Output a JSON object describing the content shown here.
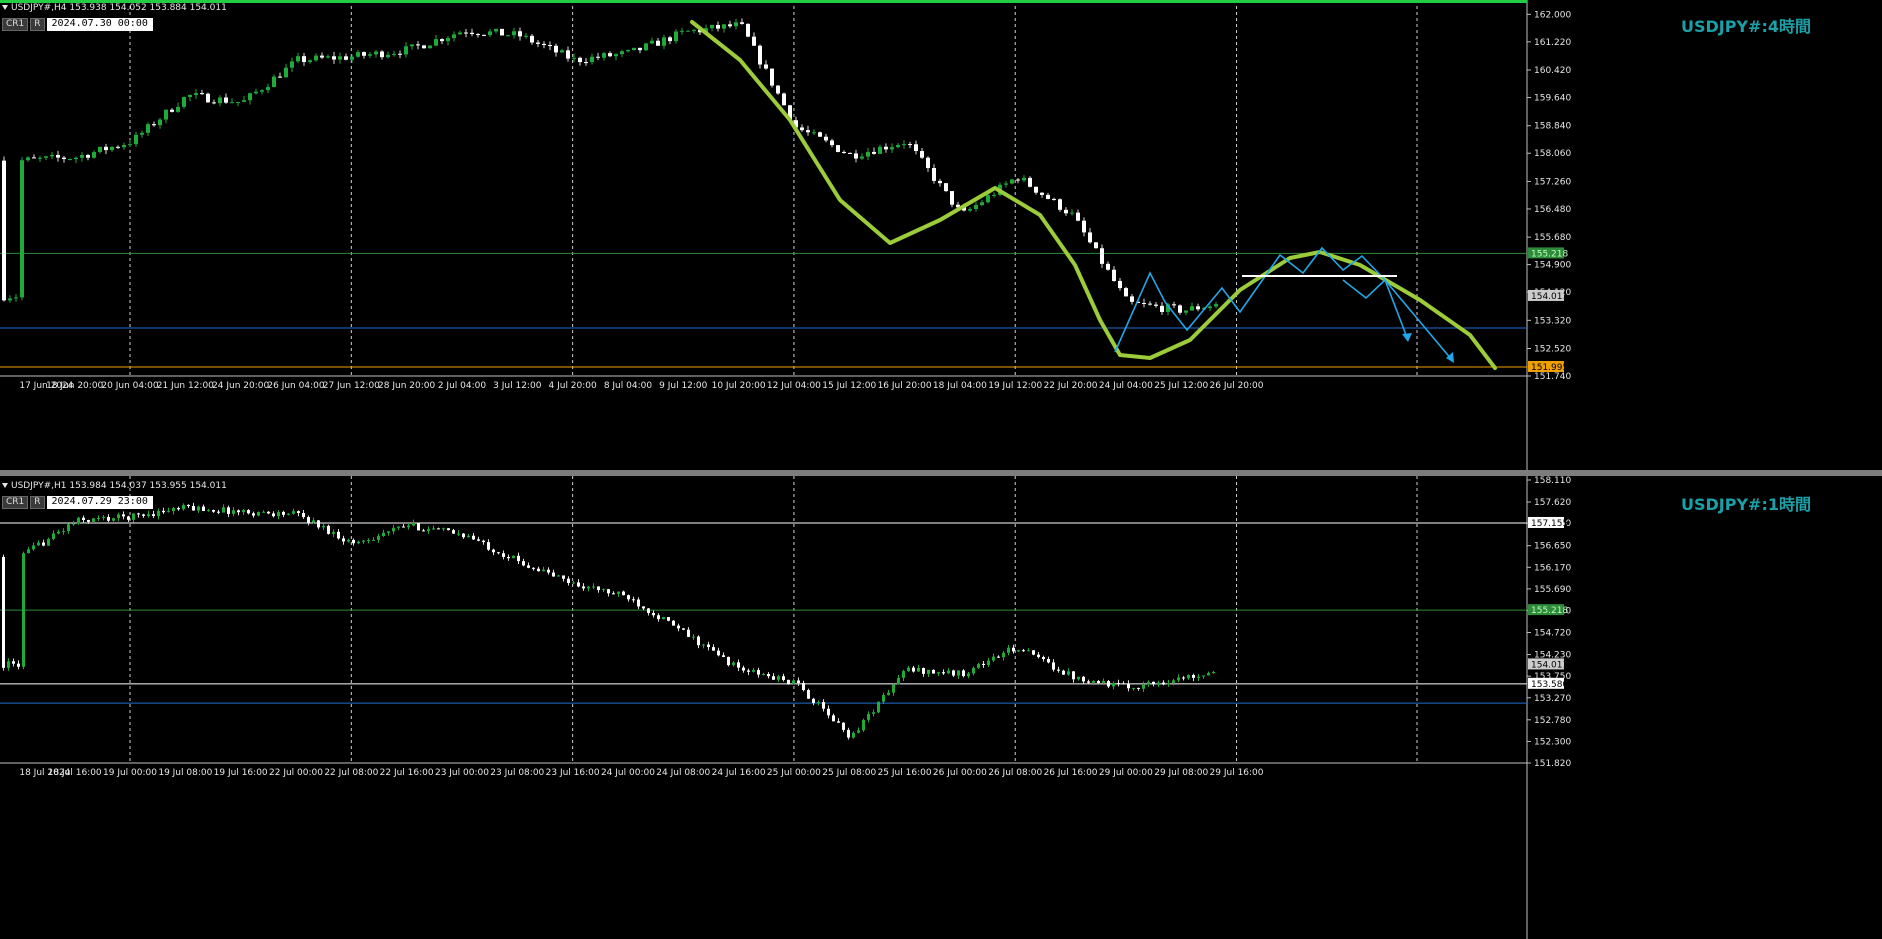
{
  "charts": {
    "h4": {
      "header": "USDJPY#,H4  153.938 154.052 153.884 154.011",
      "badge1": "CR1",
      "badge2": "R",
      "datetime": "2024.07.30 00:00",
      "watermark": "USDJPY#:4時間",
      "yticks": [
        "162.000",
        "161.220",
        "160.420",
        "159.640",
        "158.840",
        "158.060",
        "157.260",
        "156.480",
        "155.680",
        "154.900",
        "154.120",
        "153.320",
        "152.520",
        "151.740"
      ],
      "xticks": [
        "17 Jun 2024",
        "18 Jun 20:00",
        "20 Jun 04:00",
        "21 Jun 12:00",
        "24 Jun 20:00",
        "26 Jun 04:00",
        "27 Jun 12:00",
        "28 Jun 20:00",
        "2 Jul 04:00",
        "3 Jul 12:00",
        "4 Jul 20:00",
        "8 Jul 04:00",
        "9 Jul 12:00",
        "10 Jul 20:00",
        "12 Jul 04:00",
        "15 Jul 12:00",
        "16 Jul 20:00",
        "18 Jul 04:00",
        "19 Jul 12:00",
        "22 Jul 20:00",
        "24 Jul 04:00",
        "25 Jul 12:00",
        "26 Jul 20:00"
      ],
      "price_labels": [
        {
          "value": "155.218",
          "color": "#2e8b3a",
          "text": "#bfffbf"
        },
        {
          "value": "154.011",
          "color": "#cccccc",
          "text": "#000000"
        },
        {
          "value": "151.995",
          "color": "#f0a000",
          "text": "#000000"
        }
      ]
    },
    "h1": {
      "header": "USDJPY#,H1  153.984 154.037 153.955 154.011",
      "badge1": "CR1",
      "badge2": "R",
      "datetime": "2024.07.29 23:00",
      "watermark": "USDJPY#:1時間",
      "yticks": [
        "158.110",
        "157.620",
        "157.150",
        "156.650",
        "156.170",
        "155.690",
        "155.210",
        "154.720",
        "154.230",
        "153.750",
        "153.270",
        "152.780",
        "152.300",
        "151.820"
      ],
      "xticks": [
        "18 Jul 2024",
        "18 Jul 16:00",
        "19 Jul 00:00",
        "19 Jul 08:00",
        "19 Jul 16:00",
        "22 Jul 00:00",
        "22 Jul 08:00",
        "22 Jul 16:00",
        "23 Jul 00:00",
        "23 Jul 08:00",
        "23 Jul 16:00",
        "24 Jul 00:00",
        "24 Jul 08:00",
        "24 Jul 16:00",
        "25 Jul 00:00",
        "25 Jul 08:00",
        "25 Jul 16:00",
        "26 Jul 00:00",
        "26 Jul 08:00",
        "26 Jul 16:00",
        "29 Jul 00:00",
        "29 Jul 08:00",
        "29 Jul 16:00"
      ],
      "price_labels": [
        {
          "value": "157.155",
          "color": "#ffffff",
          "text": "#000000"
        },
        {
          "value": "155.218",
          "color": "#2e8b3a",
          "text": "#bfffbf"
        },
        {
          "value": "154.011",
          "color": "#cccccc",
          "text": "#000000"
        },
        {
          "value": "153.580",
          "color": "#ffffff",
          "text": "#000000"
        }
      ]
    }
  },
  "chart_data": [
    {
      "type": "candlestick",
      "symbol": "USDJPY#",
      "timeframe": "H4",
      "ylim": [
        151.74,
        162.18
      ],
      "horizontal_levels": [
        {
          "price": 155.218,
          "color": "#2e8b3a"
        },
        {
          "price": 153.1,
          "color": "#1e6fd0"
        },
        {
          "price": 151.995,
          "color": "#f0a000"
        }
      ],
      "close_path": [
        {
          "x": "17 Jun 2024",
          "y": 157.85
        },
        {
          "x": "18 Jun 20:00",
          "y": 157.95
        },
        {
          "x": "20 Jun 04:00",
          "y": 158.4
        },
        {
          "x": "21 Jun 12:00",
          "y": 159.7
        },
        {
          "x": "24 Jun 20:00",
          "y": 159.5
        },
        {
          "x": "26 Jun 04:00",
          "y": 160.7
        },
        {
          "x": "27 Jun 12:00",
          "y": 160.8
        },
        {
          "x": "28 Jun 20:00",
          "y": 161.0
        },
        {
          "x": "2 Jul 04:00",
          "y": 161.55
        },
        {
          "x": "3 Jul 12:00",
          "y": 161.4
        },
        {
          "x": "4 Jul 20:00",
          "y": 160.7
        },
        {
          "x": "8 Jul 04:00",
          "y": 160.9
        },
        {
          "x": "9 Jul 12:00",
          "y": 161.5
        },
        {
          "x": "10 Jul 20:00",
          "y": 161.7
        },
        {
          "x": "12 Jul 04:00",
          "y": 158.8
        },
        {
          "x": "15 Jul 12:00",
          "y": 158.0
        },
        {
          "x": "16 Jul 20:00",
          "y": 158.4
        },
        {
          "x": "18 Jul 04:00",
          "y": 156.3
        },
        {
          "x": "19 Jul 12:00",
          "y": 157.4
        },
        {
          "x": "22 Jul 20:00",
          "y": 156.3
        },
        {
          "x": "24 Jul 04:00",
          "y": 153.8
        },
        {
          "x": "25 Jul 12:00",
          "y": 153.6
        },
        {
          "x": "26 Jul 20:00",
          "y": 153.9
        },
        {
          "x": "30 Jul 00:00",
          "y": 154.011
        }
      ]
    },
    {
      "type": "candlestick",
      "symbol": "USDJPY#",
      "timeframe": "H1",
      "ylim": [
        151.82,
        158.11
      ],
      "horizontal_levels": [
        {
          "price": 157.155,
          "color": "#ffffff"
        },
        {
          "price": 155.218,
          "color": "#2e8b3a"
        },
        {
          "price": 153.58,
          "color": "#ffffff"
        },
        {
          "price": 153.15,
          "color": "#1e6fd0"
        }
      ],
      "close_path": [
        {
          "x": "18 Jul 2024",
          "y": 156.4
        },
        {
          "x": "18 Jul 16:00",
          "y": 157.2
        },
        {
          "x": "19 Jul 00:00",
          "y": 157.3
        },
        {
          "x": "19 Jul 08:00",
          "y": 157.5
        },
        {
          "x": "19 Jul 16:00",
          "y": 157.4
        },
        {
          "x": "22 Jul 00:00",
          "y": 157.35
        },
        {
          "x": "22 Jul 08:00",
          "y": 156.7
        },
        {
          "x": "22 Jul 16:00",
          "y": 157.1
        },
        {
          "x": "23 Jul 00:00",
          "y": 156.9
        },
        {
          "x": "23 Jul 08:00",
          "y": 156.3
        },
        {
          "x": "23 Jul 16:00",
          "y": 155.8
        },
        {
          "x": "24 Jul 00:00",
          "y": 155.5
        },
        {
          "x": "24 Jul 08:00",
          "y": 154.7
        },
        {
          "x": "24 Jul 16:00",
          "y": 153.9
        },
        {
          "x": "25 Jul 00:00",
          "y": 153.6
        },
        {
          "x": "25 Jul 08:00",
          "y": 152.4
        },
        {
          "x": "25 Jul 16:00",
          "y": 153.9
        },
        {
          "x": "26 Jul 00:00",
          "y": 153.8
        },
        {
          "x": "26 Jul 08:00",
          "y": 154.4
        },
        {
          "x": "26 Jul 16:00",
          "y": 153.75
        },
        {
          "x": "29 Jul 00:00",
          "y": 153.5
        },
        {
          "x": "29 Jul 08:00",
          "y": 153.7
        },
        {
          "x": "29 Jul 16:00",
          "y": 154.011
        }
      ]
    }
  ]
}
